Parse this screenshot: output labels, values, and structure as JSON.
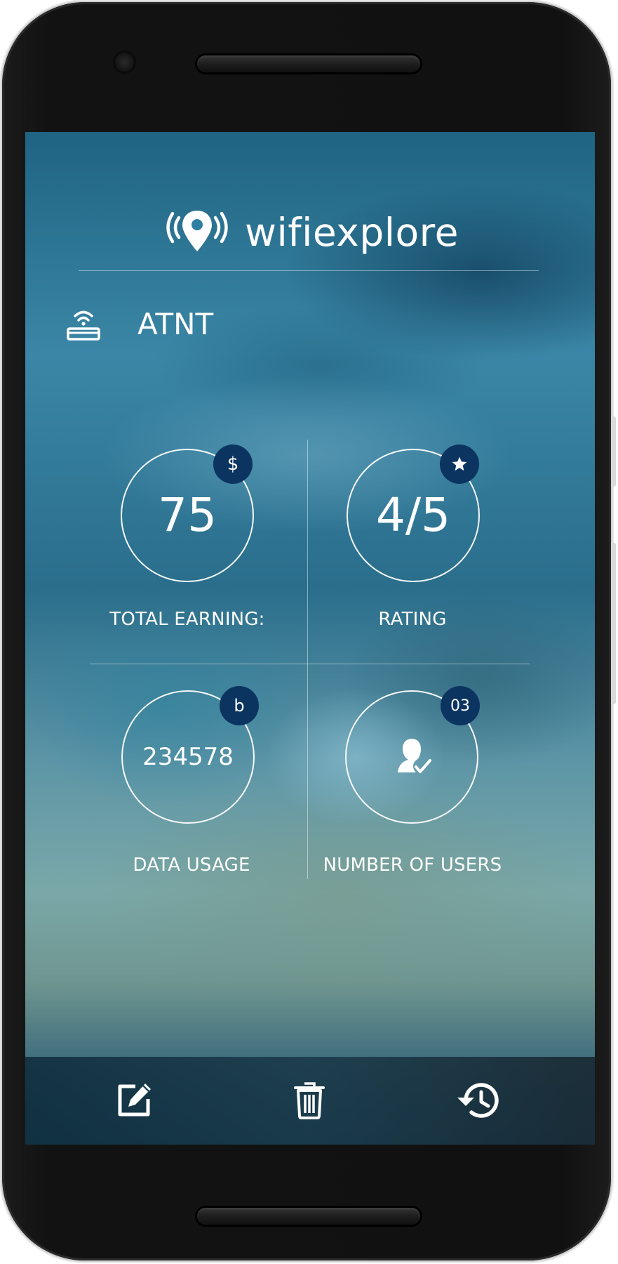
{
  "app": {
    "brand_name": "wifiexplore"
  },
  "network": {
    "name": "ATNT"
  },
  "stats": {
    "total_earning": {
      "value": "75",
      "badge": "$",
      "label": "TOTAL EARNING:"
    },
    "rating": {
      "value": "4/5",
      "badge_icon": "star-icon",
      "label": "RATING"
    },
    "data_usage": {
      "value": "234578",
      "badge": "b",
      "label": "DATA USAGE"
    },
    "users": {
      "value_icon": "user-check-icon",
      "badge": "03",
      "label": "NUMBER OF USERS"
    }
  },
  "toolbar": {
    "items": [
      {
        "icon": "edit-icon"
      },
      {
        "icon": "trash-icon"
      },
      {
        "icon": "history-icon"
      }
    ]
  },
  "colors": {
    "badge": "#0b3461",
    "text": "#ffffff"
  }
}
